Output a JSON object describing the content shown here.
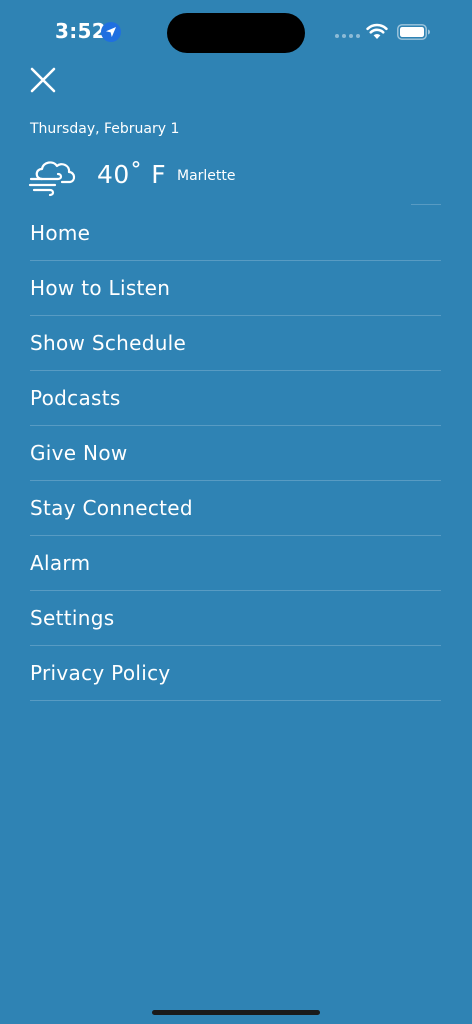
{
  "status_bar": {
    "time": "3:52"
  },
  "header": {
    "date": "Thursday, February 1",
    "temperature": "40˚ F",
    "location": "Marlette",
    "weather_icon": "windy-cloud-icon"
  },
  "menu": {
    "items": [
      {
        "label": "Home"
      },
      {
        "label": "How to Listen"
      },
      {
        "label": "Show Schedule"
      },
      {
        "label": "Podcasts"
      },
      {
        "label": "Give Now"
      },
      {
        "label": "Stay Connected"
      },
      {
        "label": "Alarm"
      },
      {
        "label": "Settings"
      },
      {
        "label": "Privacy Policy"
      }
    ]
  },
  "colors": {
    "background": "#2f83b4",
    "text": "#ffffff",
    "location_badge": "#1f6fe0"
  }
}
